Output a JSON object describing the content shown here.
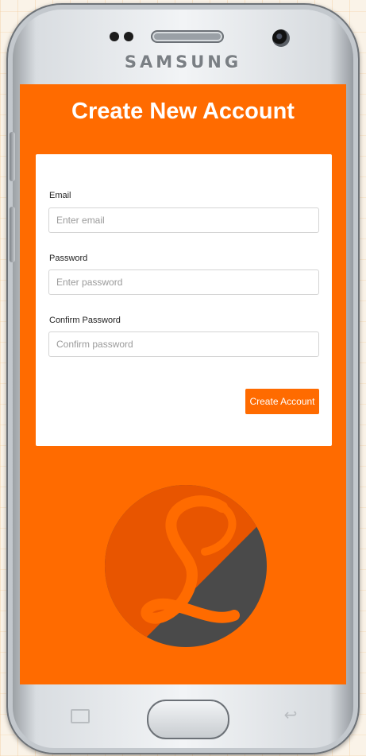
{
  "device": {
    "brand": "SAMSUNG"
  },
  "page": {
    "title": "Create New Account"
  },
  "form": {
    "email": {
      "label": "Email",
      "placeholder": "Enter email",
      "value": ""
    },
    "password": {
      "label": "Password",
      "placeholder": "Enter password",
      "value": ""
    },
    "confirm_password": {
      "label": "Confirm Password",
      "placeholder": "Confirm password",
      "value": ""
    },
    "submit_label": "Create Account"
  },
  "logo": {
    "letter": "L",
    "icon": "script-L-logo",
    "colors": {
      "upper": "#e85500",
      "lower": "#4a4a4a",
      "letter": "#ff6b00"
    }
  },
  "nav": {
    "recent_icon": "recent-apps-icon",
    "home_icon": "home-button",
    "back_icon": "back-icon"
  },
  "colors": {
    "accent": "#ff6b00",
    "card": "#ffffff",
    "text": "#222222"
  }
}
